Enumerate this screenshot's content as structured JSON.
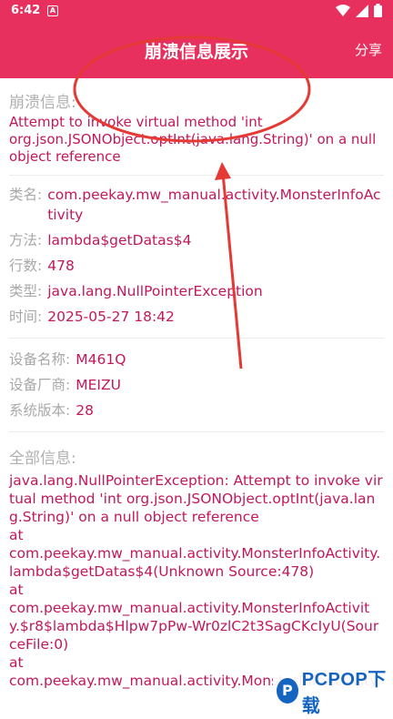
{
  "status_bar": {
    "time": "6:42",
    "notification_glyph": "A"
  },
  "app_bar": {
    "title": "崩溃信息展示",
    "share_label": "分享"
  },
  "crash_info": {
    "label": "崩溃信息:",
    "message": "Attempt to invoke virtual method 'int org.json.JSONObject.optInt(java.lang.String)' on a null object reference"
  },
  "details": [
    {
      "key": "类名:",
      "value": "com.peekay.mw_manual.activity.MonsterInfoActivity"
    },
    {
      "key": "方法:",
      "value": "lambda$getDatas$4"
    },
    {
      "key": "行数:",
      "value": "478"
    },
    {
      "key": "类型:",
      "value": "java.lang.NullPointerException"
    },
    {
      "key": "时间:",
      "value": "2025-05-27 18:42"
    }
  ],
  "device": [
    {
      "key": "设备名称:",
      "value": "M461Q"
    },
    {
      "key": "设备厂商:",
      "value": "MEIZU"
    },
    {
      "key": "系统版本:",
      "value": "28"
    }
  ],
  "full_info": {
    "label": "全部信息:",
    "text": "java.lang.NullPointerException: Attempt to invoke virtual method 'int org.json.JSONObject.optInt(java.lang.String)' on a null object reference\n  at\ncom.peekay.mw_manual.activity.MonsterInfoActivity.lambda$getDatas$4(Unknown Source:478)\n  at\ncom.peekay.mw_manual.activity.MonsterInfoActivity.$r8$lambda$Hlpw7pPw-Wr0zlC2t3SagCKcIyU(SourceFile:0)\n  at\ncom.peekay.mw_manual.activity.MonsterInfoActivity"
  },
  "watermark": {
    "text": "PCPOP下载"
  },
  "colors": {
    "accent": "#e8305f",
    "value_text": "#c2185b",
    "label_text": "#a8a8a8",
    "annotation": "#e53935"
  }
}
